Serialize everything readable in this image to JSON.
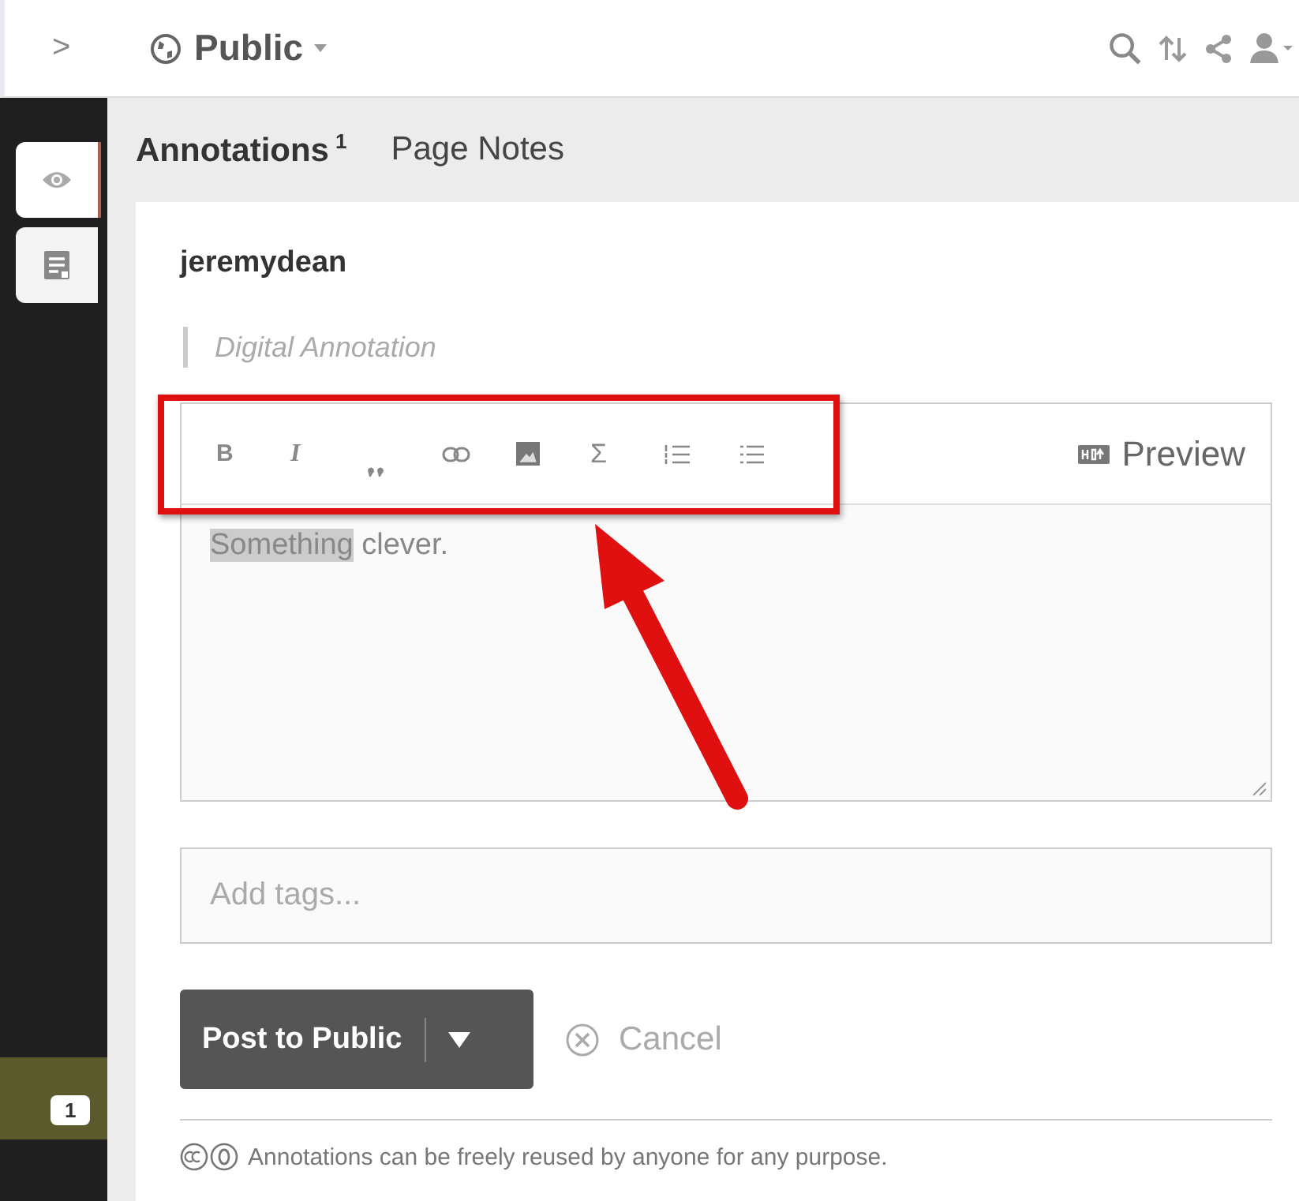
{
  "top_bar": {
    "expand": ">",
    "group": "Public"
  },
  "side_tabs": [
    {
      "kind": "eye",
      "selected": true
    },
    {
      "kind": "notes",
      "selected": false
    }
  ],
  "side_badge": "1",
  "tabs": [
    {
      "label": "Annotations",
      "count": "1",
      "selected": true
    },
    {
      "label": "Page Notes",
      "selected": false
    }
  ],
  "card": {
    "username": "jeremydean",
    "quote": "Digital Annotation",
    "toolbar": [
      {
        "kind": "bold",
        "label": "B"
      },
      {
        "kind": "italic",
        "label": "I"
      },
      {
        "kind": "quote"
      },
      {
        "kind": "link"
      },
      {
        "kind": "image"
      },
      {
        "kind": "math",
        "label": "Σ"
      },
      {
        "kind": "numbered-list"
      },
      {
        "kind": "bulleted-list"
      }
    ],
    "preview": "Preview",
    "body": [
      {
        "text": "Something",
        "selected": true
      },
      {
        "text": " clever.",
        "selected": false
      }
    ],
    "tags_placeholder": "Add tags...",
    "post": "Post to Public",
    "cancel": "Cancel",
    "license": "Annotations can be freely reused by anyone for any purpose."
  }
}
